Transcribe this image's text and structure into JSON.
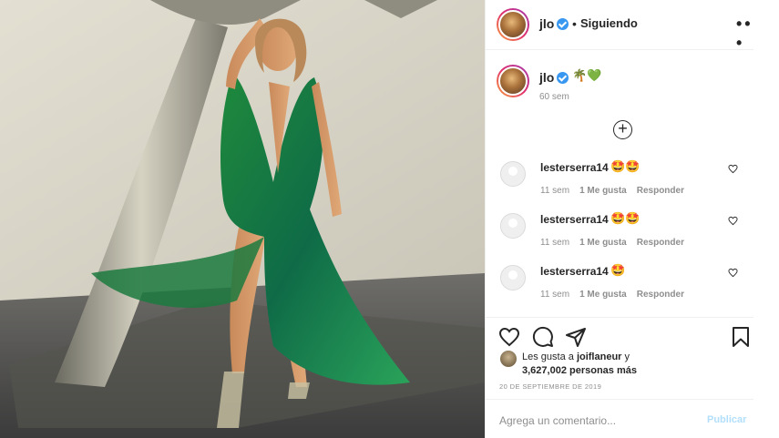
{
  "post": {
    "photo_alt": "jlo post photo"
  },
  "header": {
    "username": "jlo",
    "separator": "•",
    "follow_status": "Siguiendo",
    "more_label": "• • •"
  },
  "caption": {
    "username": "jlo",
    "text": "🌴💚",
    "time": "60 sem",
    "load_more": "+"
  },
  "comments": [
    {
      "username": "lesterserra14",
      "text": "🤩🤩",
      "time": "11 sem",
      "likes": "1 Me gusta",
      "reply": "Responder"
    },
    {
      "username": "lesterserra14",
      "text": "🤩🤩",
      "time": "11 sem",
      "likes": "1 Me gusta",
      "reply": "Responder"
    },
    {
      "username": "lesterserra14",
      "text": "🤩",
      "time": "11 sem",
      "likes": "1 Me gusta",
      "reply": "Responder"
    }
  ],
  "actions": {
    "icons": [
      "heart-icon",
      "comment-icon",
      "share-icon",
      "bookmark-icon"
    ]
  },
  "likes": {
    "prefix": "Les gusta a ",
    "liker": "joiflaneur",
    "suffix": " y",
    "count_text": "3,627,002 personas más"
  },
  "date": "20 DE SEPTIEMBRE DE 2019",
  "add_comment": {
    "placeholder": "Agrega un comentario...",
    "publish": "Publicar"
  },
  "colors": {
    "link_disabled": "#b2dffc",
    "verified": "#3897f0",
    "muted": "#8e8e8e"
  }
}
